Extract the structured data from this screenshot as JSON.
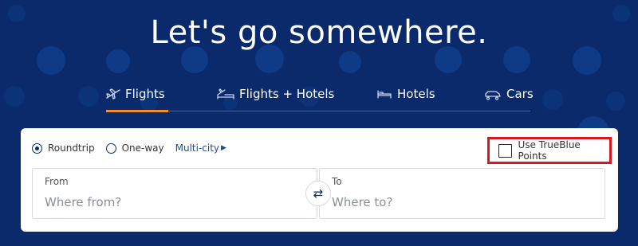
{
  "headline": "Let's go somewhere.",
  "tabs": [
    {
      "label": "Flights",
      "icon": "plane-icon",
      "active": true
    },
    {
      "label": "Flights + Hotels",
      "icon": "plane-bed-icon",
      "active": false
    },
    {
      "label": "Hotels",
      "icon": "bed-icon",
      "active": false
    },
    {
      "label": "Cars",
      "icon": "car-icon",
      "active": false
    }
  ],
  "trip_type": {
    "roundtrip": "Roundtrip",
    "oneway": "One-way",
    "multicity": "Multi-city",
    "selected": "Roundtrip"
  },
  "points": {
    "label": "Use TrueBlue Points",
    "checked": false
  },
  "from_field": {
    "label": "From",
    "placeholder": "Where from?"
  },
  "to_field": {
    "label": "To",
    "placeholder": "Where to?"
  },
  "colors": {
    "background": "#0a2a6b",
    "active_tab_underline": "#f08f2a",
    "highlight_box": "#d61a1f",
    "link": "#1b4ea0"
  }
}
